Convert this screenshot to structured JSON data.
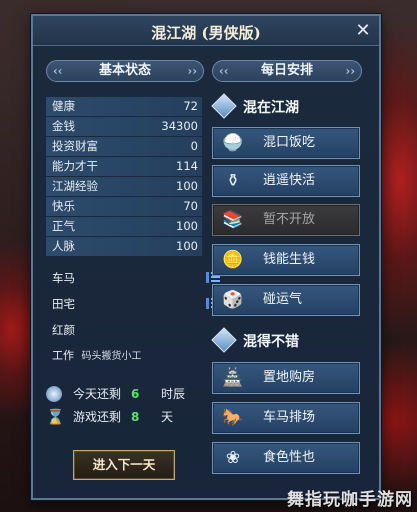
{
  "window": {
    "title": "混江湖 (男侠版)"
  },
  "left": {
    "header": "基本状态",
    "stats": [
      {
        "label": "健康",
        "value": "72"
      },
      {
        "label": "金钱",
        "value": "34300"
      },
      {
        "label": "投资财富",
        "value": "0"
      },
      {
        "label": "能力才干",
        "value": "114"
      },
      {
        "label": "江湖经验",
        "value": "100"
      },
      {
        "label": "快乐",
        "value": "70"
      },
      {
        "label": "正气",
        "value": "100"
      },
      {
        "label": "人脉",
        "value": "100"
      }
    ],
    "assets": [
      {
        "label": "车马"
      },
      {
        "label": "田宅"
      },
      {
        "label": "红颜"
      }
    ],
    "work_label": "工作",
    "work_value": "码头搬货小工",
    "remaining": [
      {
        "label": "今天还剩",
        "value": "6",
        "unit": "时辰"
      },
      {
        "label": "游戏还剩",
        "value": "8",
        "unit": "天"
      }
    ],
    "next_day_button": "进入下一天"
  },
  "right": {
    "header": "每日安排",
    "groups": [
      {
        "title": "混在江湖",
        "buttons": [
          {
            "label": "混口饭吃",
            "icon": "bowl-icon",
            "enabled": true
          },
          {
            "label": "逍遥快活",
            "icon": "wine-jar-icon",
            "enabled": true
          },
          {
            "label": "暂不开放",
            "icon": "books-icon",
            "enabled": false
          },
          {
            "label": "钱能生钱",
            "icon": "coins-icon",
            "enabled": true
          },
          {
            "label": "碰运气",
            "icon": "dice-icon",
            "enabled": true
          }
        ]
      },
      {
        "title": "混得不错",
        "buttons": [
          {
            "label": "置地购房",
            "icon": "house-icon",
            "enabled": true
          },
          {
            "label": "车马排场",
            "icon": "horse-icon",
            "enabled": true
          },
          {
            "label": "食色性也",
            "icon": "flower-icon",
            "enabled": true
          }
        ]
      }
    ]
  },
  "watermark": "舞指玩咖手游网",
  "colors": {
    "accent_green": "#5fe06a",
    "panel_blue": "#244163",
    "border_gold": "#c8a96b"
  }
}
